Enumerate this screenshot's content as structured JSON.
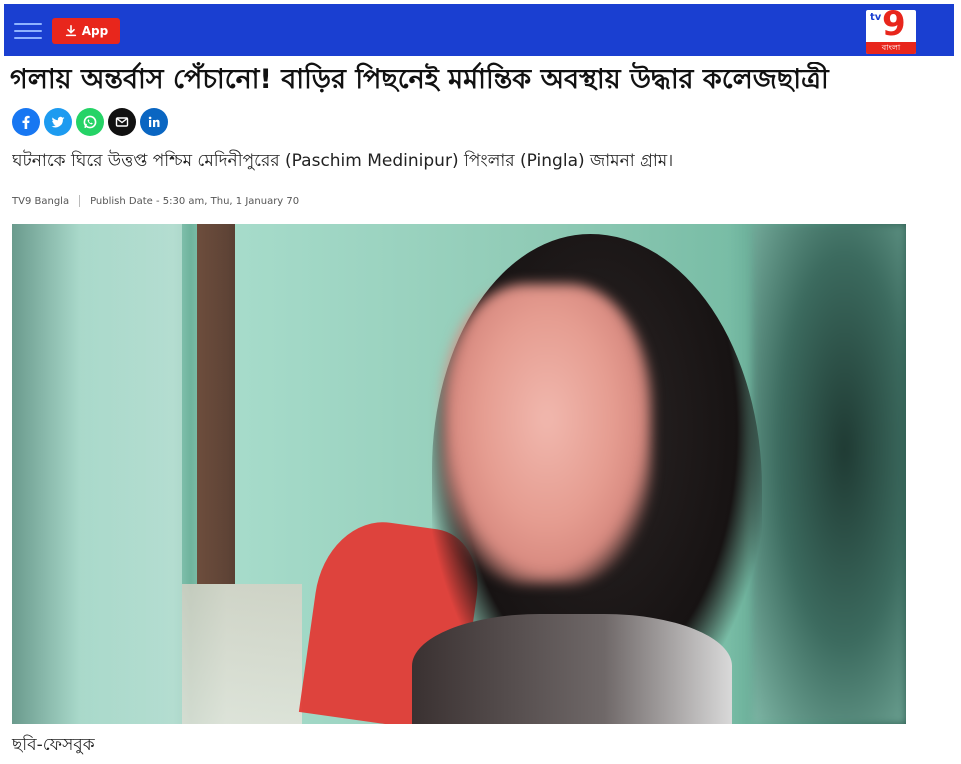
{
  "header": {
    "menu_icon": "hamburger-icon",
    "app_button_label": "App",
    "app_button_icon": "download-icon",
    "logo": {
      "tv_text": "tv",
      "number_text": "9",
      "sub_text": "বাংলা"
    },
    "colors": {
      "bar": "#1a3fd1",
      "app_button": "#e8261c",
      "logo_accent": "#e8261c"
    }
  },
  "article": {
    "headline": "গলায় অন্তর্বাস পেঁচানো! বাড়ির পিছনেই মর্মান্তিক অবস্থায় উদ্ধার কলেজছাত্রী",
    "share_buttons": [
      {
        "name": "facebook",
        "icon": "facebook-icon",
        "color": "#1877f2"
      },
      {
        "name": "twitter",
        "icon": "twitter-icon",
        "color": "#1d9bf0"
      },
      {
        "name": "whatsapp",
        "icon": "whatsapp-icon",
        "color": "#25d366"
      },
      {
        "name": "email",
        "icon": "email-icon",
        "color": "#111111"
      },
      {
        "name": "linkedin",
        "icon": "linkedin-icon",
        "color": "#0a66c2"
      }
    ],
    "subheadline": "ঘটনাকে ঘিরে উত্তপ্ত পশ্চিম মেদিনীপুরের (Paschim Medinipur) পিংলার (Pingla) জামনা গ্রাম।",
    "meta": {
      "source": "TV9 Bangla",
      "publish_date": "Publish Date - 5:30 am, Thu, 1 January 70"
    },
    "image_caption": "ছবি-ফেসবুক"
  }
}
